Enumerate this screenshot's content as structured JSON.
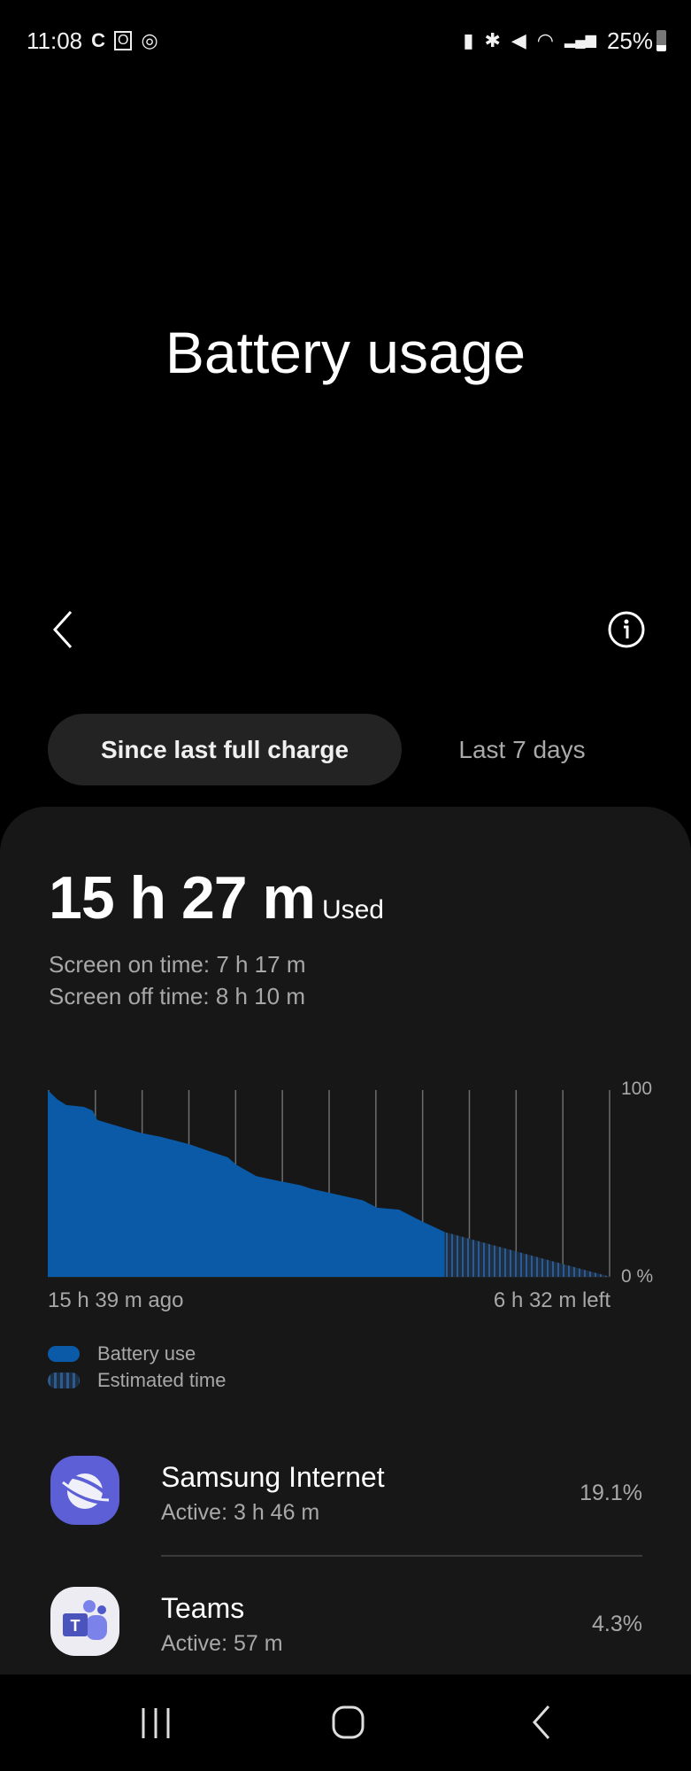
{
  "status_bar": {
    "time": "11:08",
    "left_icons": [
      "sync-icon",
      "outlook-icon",
      "fingerprint-icon"
    ],
    "right_icons": [
      "battery-saver-icon",
      "bluetooth-icon",
      "mute-icon",
      "wifi-icon",
      "signal-icon"
    ],
    "battery": "25%"
  },
  "header": {
    "title": "Battery usage",
    "back_icon": "chevron-left-icon",
    "info_icon": "info-icon"
  },
  "tabs": [
    {
      "label": "Since last full charge",
      "selected": true
    },
    {
      "label": "Last 7 days",
      "selected": false
    }
  ],
  "summary": {
    "used_value": "15 h 27 m",
    "used_label": "Used",
    "screen_on": "Screen on time: 7 h 17 m",
    "screen_off": "Screen off time: 8 h 10 m"
  },
  "colors": {
    "battery_use": "#0a5aa8",
    "background": "#171717"
  },
  "chart_data": {
    "type": "area",
    "x_unit": "hours relative to now",
    "xlim": [
      -15.65,
      6.53
    ],
    "ylim": [
      0,
      100
    ],
    "y_tick_labels": [
      "100",
      "0 %"
    ],
    "x_tick_labels": [
      "15 h 39 m ago",
      "6 h 32 m left"
    ],
    "grid": "vertical",
    "legend_placement": "bottom-left",
    "series": [
      {
        "name": "Battery use",
        "color": "#0a5aa8",
        "points": [
          [
            -15.65,
            100
          ],
          [
            -15.27,
            95
          ],
          [
            -14.92,
            92
          ],
          [
            -14.23,
            91
          ],
          [
            -13.88,
            89
          ],
          [
            -13.7,
            84
          ],
          [
            -13.21,
            82
          ],
          [
            -11.97,
            77
          ],
          [
            -11.21,
            75
          ],
          [
            -10.06,
            71
          ],
          [
            -9.22,
            67
          ],
          [
            -8.55,
            64
          ],
          [
            -8.22,
            60
          ],
          [
            -7.44,
            54
          ],
          [
            -6.78,
            52
          ],
          [
            -5.67,
            49
          ],
          [
            -5.23,
            47
          ],
          [
            -4.56,
            45
          ],
          [
            -3.23,
            41
          ],
          [
            -2.67,
            37
          ],
          [
            -1.81,
            36
          ],
          [
            -0.94,
            30
          ],
          [
            0,
            24
          ]
        ]
      },
      {
        "name": "Estimated time",
        "color": "#2a4a70",
        "points": [
          [
            0,
            24
          ],
          [
            6.53,
            0
          ]
        ]
      }
    ]
  },
  "apps": [
    {
      "name": "Samsung Internet",
      "active": "Active: 3 h 46 m",
      "percent": "19.1%",
      "icon": "samsung-internet-icon"
    },
    {
      "name": "Teams",
      "active": "Active: 57 m",
      "percent": "4.3%",
      "icon": "teams-icon"
    }
  ],
  "nav_bar": [
    "recents-icon",
    "home-icon",
    "back-icon"
  ]
}
